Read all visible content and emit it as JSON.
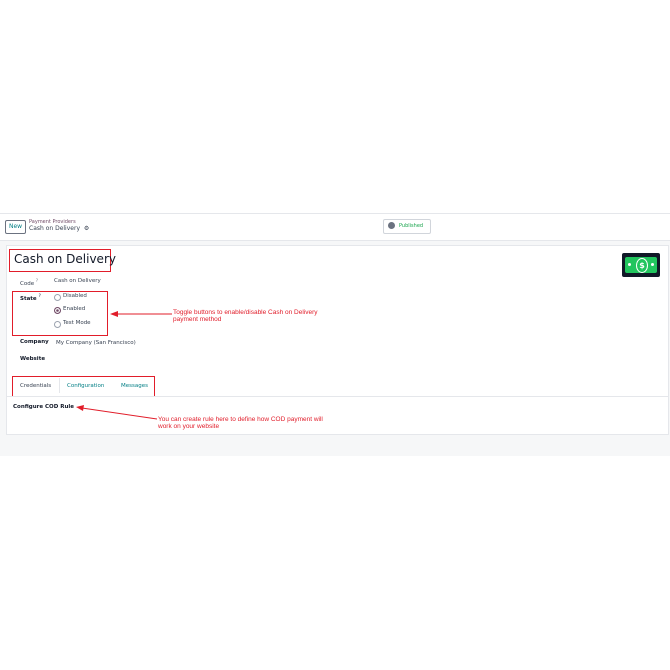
{
  "control_panel": {
    "new_button": "New",
    "breadcrumb_parent": "Payment Providers",
    "breadcrumb_current": "Cash on Delivery",
    "published_label": "Published"
  },
  "form": {
    "title": "Cash on Delivery",
    "code_label": "Code",
    "code_value": "Cash on Delivery",
    "help_mark": "?",
    "state_label": "State",
    "state_options": [
      {
        "label": "Disabled",
        "selected": false
      },
      {
        "label": "Enabled",
        "selected": true
      },
      {
        "label": "Test Mode",
        "selected": false
      }
    ],
    "company_label": "Company",
    "company_value": "My Company (San Francisco)",
    "website_label": "Website",
    "tabs": [
      "Credentials",
      "Configuration",
      "Messages"
    ],
    "tab_content_title": "Configure COD Rule"
  },
  "annotations": {
    "state_note": "Toggle buttons to enable/disable Cash on Delivery payment method",
    "cod_note": "You can create rule here to define how COD payment will work on your website"
  },
  "colors": {
    "annotation": "#e11d2a",
    "link": "#017e84",
    "brand": "#714b67",
    "published": "#16a34a"
  }
}
